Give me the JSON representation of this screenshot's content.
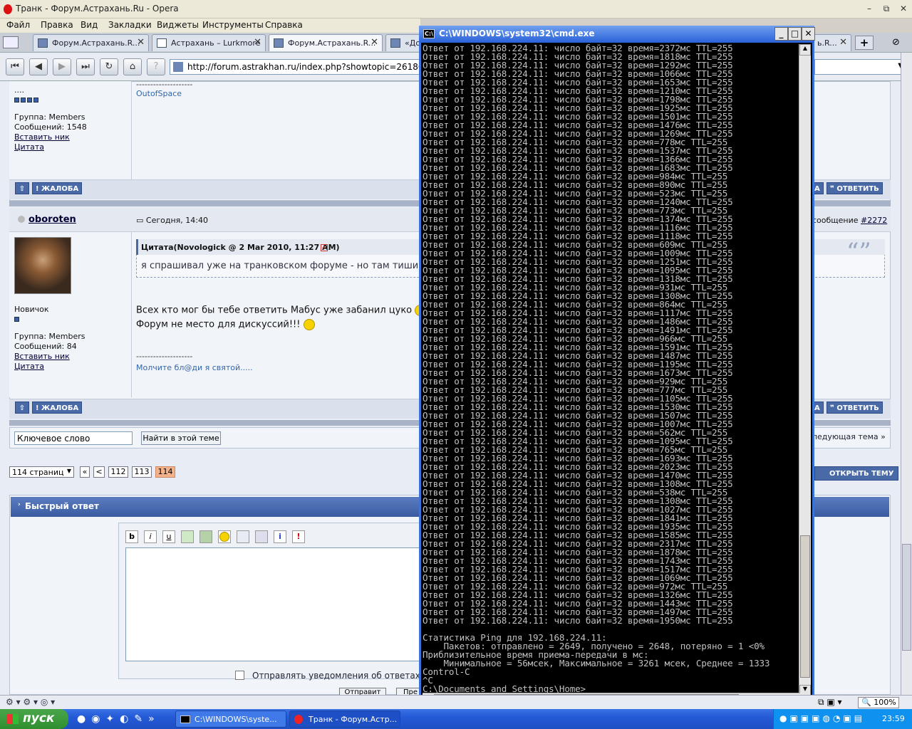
{
  "window": {
    "title": "Транк - Форум.Астрахань.Ru - Opera"
  },
  "menu": [
    "Файл",
    "Правка",
    "Вид",
    "Закладки",
    "Виджеты",
    "Инструменты",
    "Справка"
  ],
  "tabs": [
    {
      "label": "Форум.Астрахань.R...",
      "active": false
    },
    {
      "label": "Астрахань – Lurkmore",
      "active": false
    },
    {
      "label": "Форум.Астрахань.R...",
      "active": true
    },
    {
      "label": "«До",
      "active": false
    },
    {
      "label": "ь.R...",
      "active": false
    }
  ],
  "address": {
    "url": "http://forum.astrakhan.ru/index.php?showtopic=26180&st=2260"
  },
  "post1": {
    "dots": "....",
    "group": "Группа: Members",
    "messages": "Сообщений: 1548",
    "insert_nick": "Вставить ник",
    "quote": "Цитата",
    "sig_line": "--------------------",
    "sig": "OutofSpace",
    "report": "ЖАЛОБА",
    "reply_a": "А",
    "reply": "ОТВЕТИТЬ"
  },
  "post2": {
    "author": "oboroten",
    "date": "Сегодня, 14:40",
    "msg_label": "сообщение",
    "msg_num": "#2272",
    "quote_header": "Цитата(Novologick @ 2 Mar 2010, 11:27 AM)",
    "quote_text": "я спрашивал уже на транковском форуме - но там тишина.",
    "rank": "Новичок",
    "group": "Группа: Members",
    "messages": "Сообщений: 84",
    "insert_nick": "Вставить ник",
    "quote": "Цитата",
    "body1": "Всех кто мог бы тебе ответить Мабус уже забанил цуко",
    "body2": "Форум не место для дискуссий!!!",
    "sig_line": "--------------------",
    "sig": "Молчите бл@ди я святой.....",
    "report": "ЖАЛОБА",
    "reply_a": "А",
    "reply": "ОТВЕТИТЬ"
  },
  "search": {
    "placeholder": "Ключевое слово",
    "button": "Найти в этой теме",
    "next": "ледующая тема »"
  },
  "pages": {
    "dropdown": "114 страниц",
    "first": "«",
    "prev": "<",
    "p1": "112",
    "p2": "113",
    "current": "114",
    "open_topic": "ОТКРЫТЬ ТЕМУ"
  },
  "quick_reply": {
    "title": "Быстрый ответ",
    "notify": "Отправлять уведомления об ответах на",
    "send": "Отправит",
    "preview": "Пре"
  },
  "cmd": {
    "title": "C:\\WINDOWS\\system32\\cmd.exe",
    "ip": "192.168.224.11",
    "ping_times": [
      "2372",
      "1818",
      "1292",
      "1066",
      "1653",
      "1210",
      "1798",
      "1925",
      "1501",
      "1476",
      "1269",
      "778",
      "1537",
      "1366",
      "1683",
      "984",
      "890",
      "523",
      "1240",
      "773",
      "1374",
      "1116",
      "1118",
      "609",
      "1009",
      "1251",
      "1095",
      "1318",
      "931",
      "1308",
      "864",
      "1117",
      "1486",
      "1491",
      "966",
      "1591",
      "1487",
      "1195",
      "1673",
      "929",
      "777",
      "1105",
      "1530",
      "1507",
      "1007",
      "562",
      "1095",
      "765",
      "1693",
      "2023",
      "1470",
      "1308",
      "538",
      "1308",
      "1027",
      "1841",
      "1935",
      "1585",
      "2317",
      "1878",
      "1743",
      "1517",
      "1069",
      "972",
      "1326",
      "1443",
      "1497",
      "1950"
    ],
    "stats": [
      "Статистика Ping для 192.168.224.11:",
      "    Пакетов: отправлено = 2649, получено = 2648, потеряно = 1 <0%",
      "Приблизительное время приема-передачи в мс:",
      "    Минимальное = 56мсек, Максимальное = 3261 мсек, Среднее = 1333",
      "Control-C",
      "^C",
      "C:\\Documents and Settings\\Home>_"
    ]
  },
  "status": {
    "zoom": "100%"
  },
  "taskbar": {
    "start": "пуск",
    "task1": "C:\\WINDOWS\\syste...",
    "task2": "Транк - Форум.Астр...",
    "clock": "23:59"
  }
}
